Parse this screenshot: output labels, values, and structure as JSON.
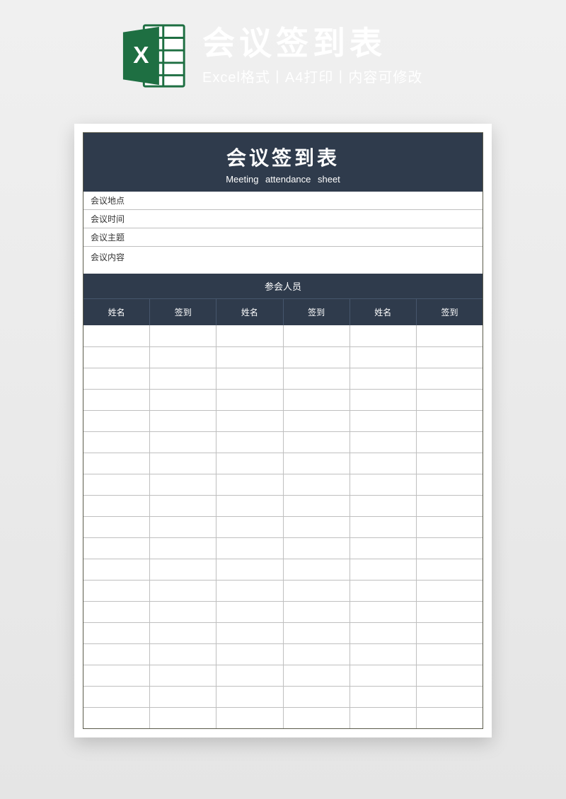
{
  "banner": {
    "title": "会议签到表",
    "subtitle": "Excel格式丨A4打印丨内容可修改",
    "icon": "excel-icon"
  },
  "sheet": {
    "header": {
      "cn": "会议签到表",
      "en": "Meeting  attendance  sheet"
    },
    "info": [
      {
        "label": "会议地点",
        "value": ""
      },
      {
        "label": "会议时间",
        "value": ""
      },
      {
        "label": "会议主题",
        "value": ""
      },
      {
        "label": "会议内容",
        "value": ""
      }
    ],
    "attendee_title": "参会人员",
    "columns": [
      "姓名",
      "签到",
      "姓名",
      "签到",
      "姓名",
      "签到"
    ],
    "row_count": 19
  }
}
